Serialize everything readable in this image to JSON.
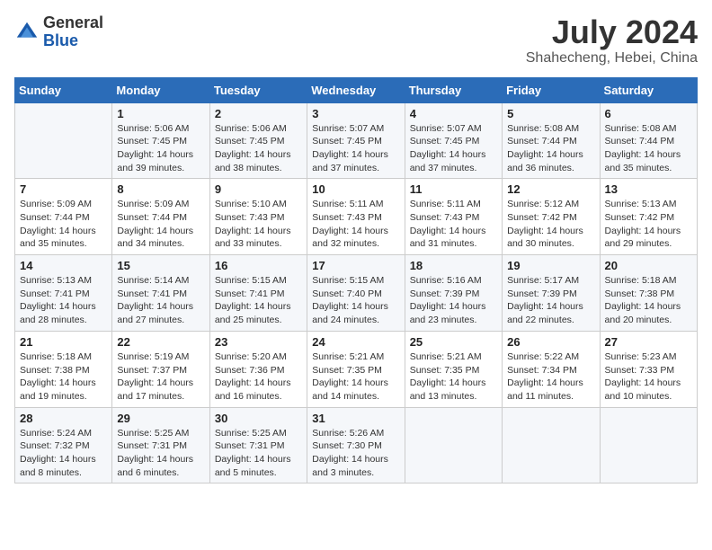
{
  "header": {
    "logo_general": "General",
    "logo_blue": "Blue",
    "month_year": "July 2024",
    "location": "Shahecheng, Hebei, China"
  },
  "weekdays": [
    "Sunday",
    "Monday",
    "Tuesday",
    "Wednesday",
    "Thursday",
    "Friday",
    "Saturday"
  ],
  "weeks": [
    [
      {
        "day": "",
        "info": ""
      },
      {
        "day": "1",
        "info": "Sunrise: 5:06 AM\nSunset: 7:45 PM\nDaylight: 14 hours\nand 39 minutes."
      },
      {
        "day": "2",
        "info": "Sunrise: 5:06 AM\nSunset: 7:45 PM\nDaylight: 14 hours\nand 38 minutes."
      },
      {
        "day": "3",
        "info": "Sunrise: 5:07 AM\nSunset: 7:45 PM\nDaylight: 14 hours\nand 37 minutes."
      },
      {
        "day": "4",
        "info": "Sunrise: 5:07 AM\nSunset: 7:45 PM\nDaylight: 14 hours\nand 37 minutes."
      },
      {
        "day": "5",
        "info": "Sunrise: 5:08 AM\nSunset: 7:44 PM\nDaylight: 14 hours\nand 36 minutes."
      },
      {
        "day": "6",
        "info": "Sunrise: 5:08 AM\nSunset: 7:44 PM\nDaylight: 14 hours\nand 35 minutes."
      }
    ],
    [
      {
        "day": "7",
        "info": "Sunrise: 5:09 AM\nSunset: 7:44 PM\nDaylight: 14 hours\nand 35 minutes."
      },
      {
        "day": "8",
        "info": "Sunrise: 5:09 AM\nSunset: 7:44 PM\nDaylight: 14 hours\nand 34 minutes."
      },
      {
        "day": "9",
        "info": "Sunrise: 5:10 AM\nSunset: 7:43 PM\nDaylight: 14 hours\nand 33 minutes."
      },
      {
        "day": "10",
        "info": "Sunrise: 5:11 AM\nSunset: 7:43 PM\nDaylight: 14 hours\nand 32 minutes."
      },
      {
        "day": "11",
        "info": "Sunrise: 5:11 AM\nSunset: 7:43 PM\nDaylight: 14 hours\nand 31 minutes."
      },
      {
        "day": "12",
        "info": "Sunrise: 5:12 AM\nSunset: 7:42 PM\nDaylight: 14 hours\nand 30 minutes."
      },
      {
        "day": "13",
        "info": "Sunrise: 5:13 AM\nSunset: 7:42 PM\nDaylight: 14 hours\nand 29 minutes."
      }
    ],
    [
      {
        "day": "14",
        "info": "Sunrise: 5:13 AM\nSunset: 7:41 PM\nDaylight: 14 hours\nand 28 minutes."
      },
      {
        "day": "15",
        "info": "Sunrise: 5:14 AM\nSunset: 7:41 PM\nDaylight: 14 hours\nand 27 minutes."
      },
      {
        "day": "16",
        "info": "Sunrise: 5:15 AM\nSunset: 7:41 PM\nDaylight: 14 hours\nand 25 minutes."
      },
      {
        "day": "17",
        "info": "Sunrise: 5:15 AM\nSunset: 7:40 PM\nDaylight: 14 hours\nand 24 minutes."
      },
      {
        "day": "18",
        "info": "Sunrise: 5:16 AM\nSunset: 7:39 PM\nDaylight: 14 hours\nand 23 minutes."
      },
      {
        "day": "19",
        "info": "Sunrise: 5:17 AM\nSunset: 7:39 PM\nDaylight: 14 hours\nand 22 minutes."
      },
      {
        "day": "20",
        "info": "Sunrise: 5:18 AM\nSunset: 7:38 PM\nDaylight: 14 hours\nand 20 minutes."
      }
    ],
    [
      {
        "day": "21",
        "info": "Sunrise: 5:18 AM\nSunset: 7:38 PM\nDaylight: 14 hours\nand 19 minutes."
      },
      {
        "day": "22",
        "info": "Sunrise: 5:19 AM\nSunset: 7:37 PM\nDaylight: 14 hours\nand 17 minutes."
      },
      {
        "day": "23",
        "info": "Sunrise: 5:20 AM\nSunset: 7:36 PM\nDaylight: 14 hours\nand 16 minutes."
      },
      {
        "day": "24",
        "info": "Sunrise: 5:21 AM\nSunset: 7:35 PM\nDaylight: 14 hours\nand 14 minutes."
      },
      {
        "day": "25",
        "info": "Sunrise: 5:21 AM\nSunset: 7:35 PM\nDaylight: 14 hours\nand 13 minutes."
      },
      {
        "day": "26",
        "info": "Sunrise: 5:22 AM\nSunset: 7:34 PM\nDaylight: 14 hours\nand 11 minutes."
      },
      {
        "day": "27",
        "info": "Sunrise: 5:23 AM\nSunset: 7:33 PM\nDaylight: 14 hours\nand 10 minutes."
      }
    ],
    [
      {
        "day": "28",
        "info": "Sunrise: 5:24 AM\nSunset: 7:32 PM\nDaylight: 14 hours\nand 8 minutes."
      },
      {
        "day": "29",
        "info": "Sunrise: 5:25 AM\nSunset: 7:31 PM\nDaylight: 14 hours\nand 6 minutes."
      },
      {
        "day": "30",
        "info": "Sunrise: 5:25 AM\nSunset: 7:31 PM\nDaylight: 14 hours\nand 5 minutes."
      },
      {
        "day": "31",
        "info": "Sunrise: 5:26 AM\nSunset: 7:30 PM\nDaylight: 14 hours\nand 3 minutes."
      },
      {
        "day": "",
        "info": ""
      },
      {
        "day": "",
        "info": ""
      },
      {
        "day": "",
        "info": ""
      }
    ]
  ]
}
